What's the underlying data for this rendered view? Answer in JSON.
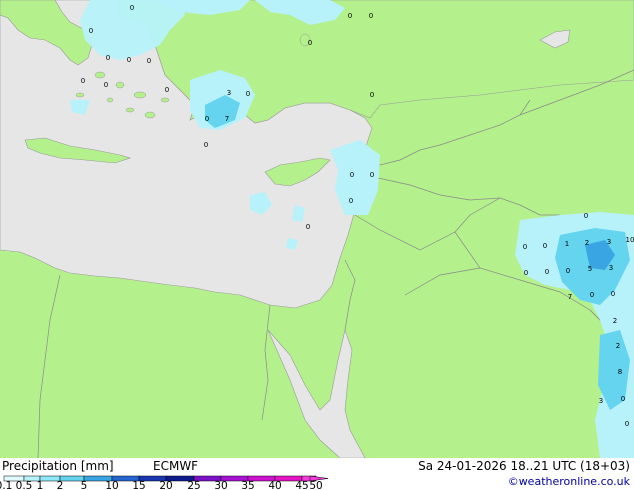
{
  "footer": {
    "title": "Precipitation [mm]",
    "model": "ECMWF",
    "datetime": "Sa 24-01-2026 18..21 UTC (18+03)",
    "credit": "©weatheronline.co.uk"
  },
  "legend": {
    "ticks": [
      "0.1",
      "0.5",
      "1",
      "2",
      "5",
      "10",
      "15",
      "20",
      "25",
      "30",
      "35",
      "40",
      "45",
      "50"
    ],
    "colors": [
      "#ffffff",
      "#dffbff",
      "#b7f2fb",
      "#8fe8f6",
      "#64d4ef",
      "#3aa5e3",
      "#2464cf",
      "#1836b0",
      "#0d1a8c",
      "#7a10c8",
      "#a810d4",
      "#cc10d0",
      "#e414c6",
      "#f03cd8"
    ]
  },
  "colors": {
    "land": "#b4f08c",
    "sea": "#e6e6e6",
    "border": "#a0a0a0",
    "precip_light": "#b7f2fb",
    "precip_mid": "#64d4ef",
    "precip_heavy": "#3aa5e3"
  },
  "map": {
    "labels": [
      "0",
      "0",
      "0",
      "0",
      "0",
      "0",
      "0",
      "0",
      "0",
      "0",
      "0",
      "3",
      "0",
      "0",
      "7",
      "0",
      "0",
      "0",
      "0",
      "0",
      "0",
      "0",
      "0",
      "0",
      "1",
      "2",
      "3",
      "10",
      "0",
      "0",
      "0",
      "5",
      "3",
      "7",
      "0",
      "0",
      "2",
      "2",
      "8",
      "3",
      "0",
      "0"
    ]
  }
}
